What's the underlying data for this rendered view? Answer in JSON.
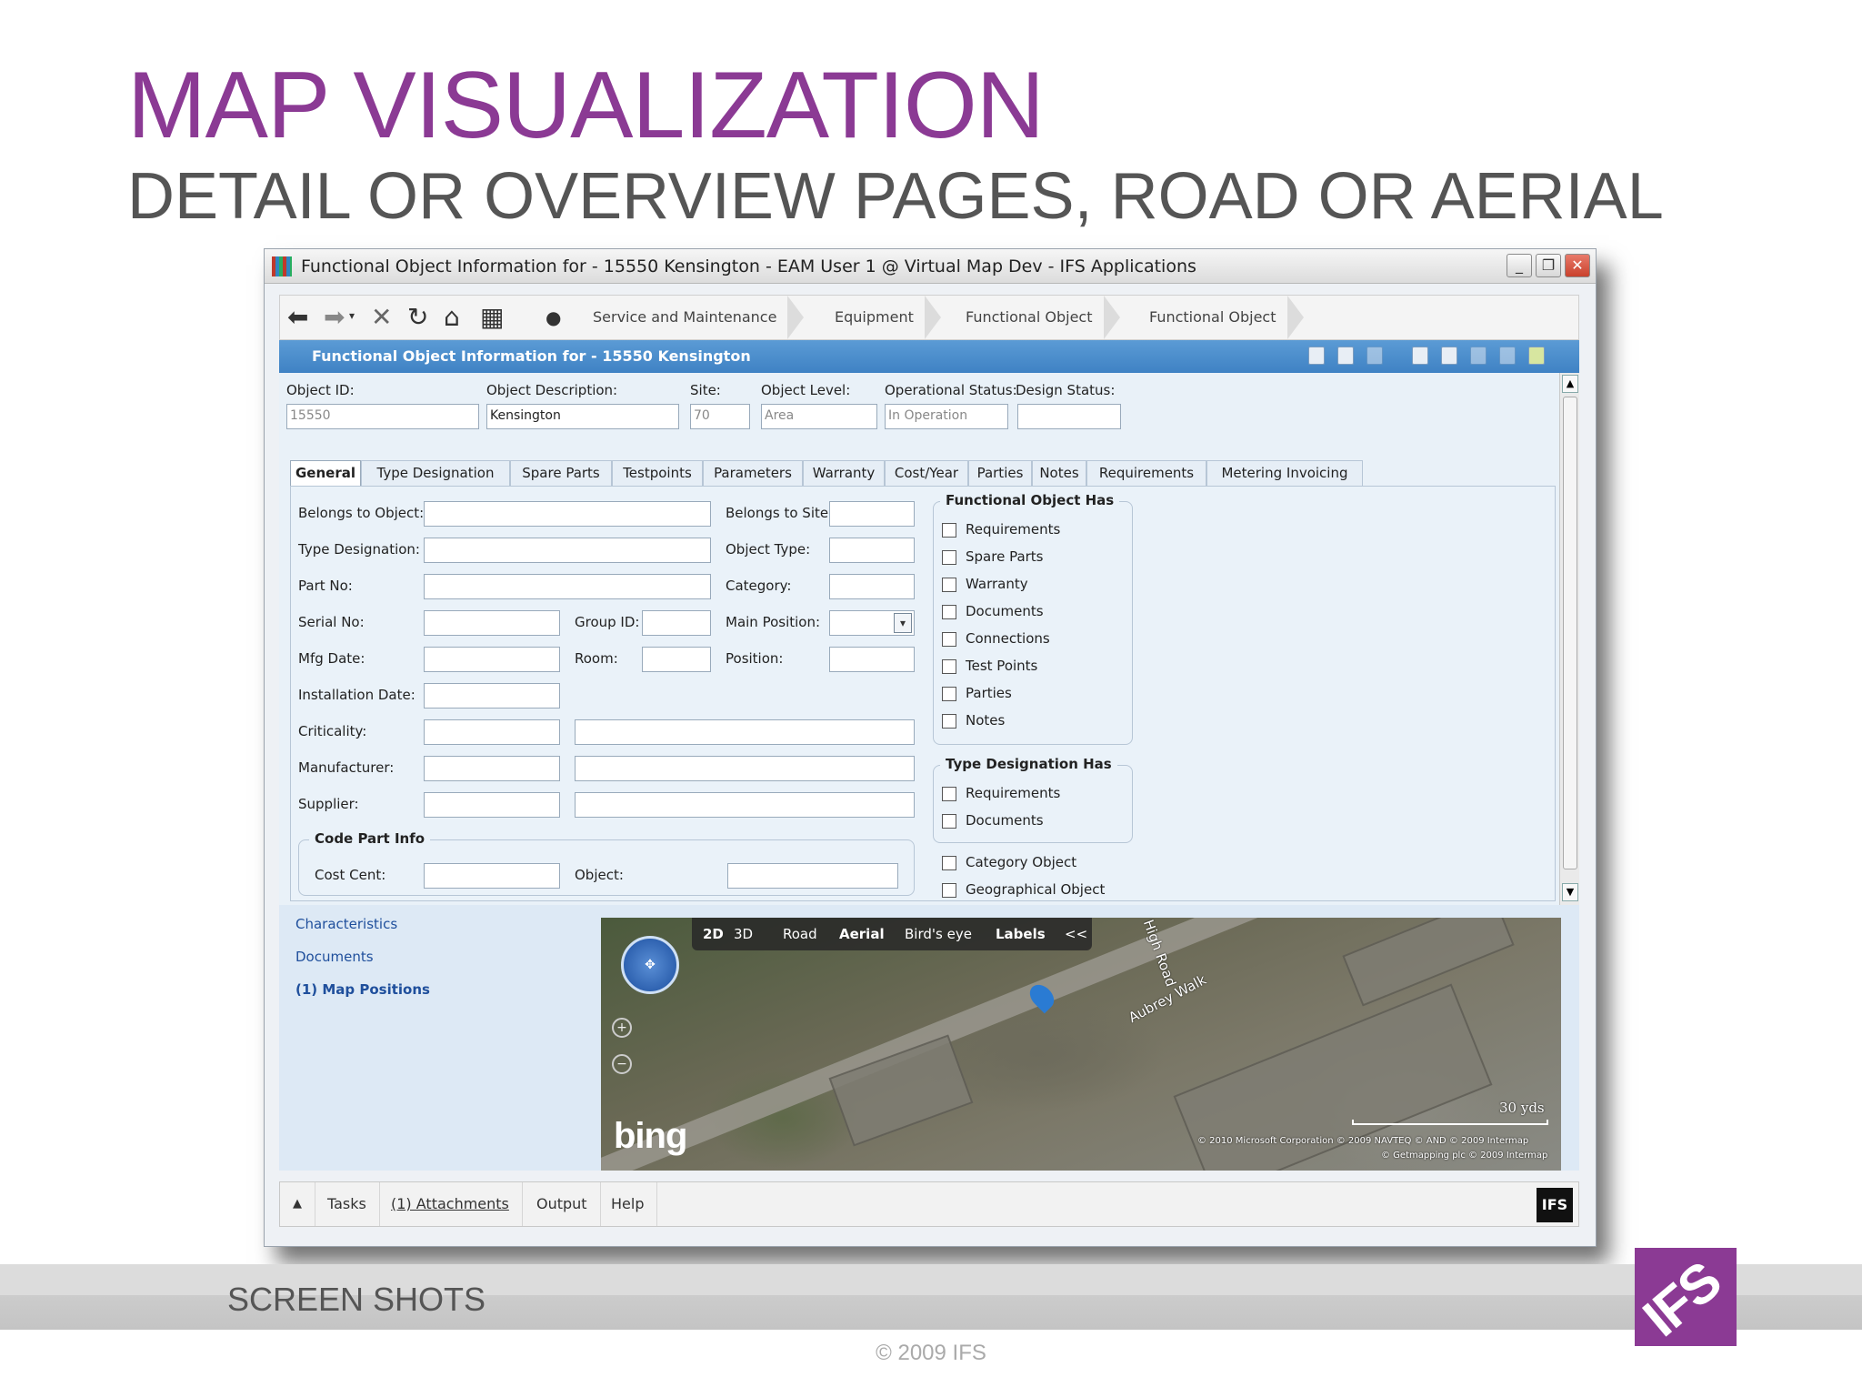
{
  "slide": {
    "title": "MAP VISUALIZATION",
    "subtitle": "DETAIL OR OVERVIEW PAGES, ROAD OR AERIAL",
    "footer_label": "SCREEN SHOTS",
    "copyright": "© 2009 IFS",
    "logo_text": "IFS",
    "accent_color": "#8b3a94"
  },
  "window": {
    "title": "Functional Object Information for - 15550 Kensington - EAM User 1 @ Virtual Map Dev - IFS Applications",
    "buttons": {
      "minimize": "_",
      "restore": "❐",
      "close": "✕"
    }
  },
  "nav": {
    "icons": [
      "back-arrow-icon",
      "forward-arrow-icon",
      "cancel-icon",
      "refresh-icon",
      "home-icon",
      "grid-icon",
      "bullet-icon"
    ],
    "breadcrumbs": [
      "Service and Maintenance",
      "Equipment",
      "Functional Object",
      "Functional Object"
    ]
  },
  "form_header": {
    "title": "Functional Object Information for - 15550 Kensington"
  },
  "header_fields": [
    {
      "label": "Object ID:",
      "value": "15550"
    },
    {
      "label": "Object Description:",
      "value": "Kensington"
    },
    {
      "label": "Site:",
      "value": "70"
    },
    {
      "label": "Object Level:",
      "value": "Area"
    },
    {
      "label": "Operational Status:",
      "value": "In Operation"
    },
    {
      "label": "Design Status:",
      "value": ""
    }
  ],
  "tabs": [
    "General",
    "Type Designation",
    "Spare Parts",
    "Testpoints",
    "Parameters",
    "Warranty",
    "Cost/Year",
    "Parties",
    "Notes",
    "Requirements",
    "Metering Invoicing"
  ],
  "general": {
    "belongs_to_object": "Belongs to Object:",
    "type_designation": "Type Designation:",
    "part_no": "Part No:",
    "serial_no": "Serial No:",
    "mfg_date": "Mfg Date:",
    "installation_date": "Installation Date:",
    "criticality": "Criticality:",
    "manufacturer": "Manufacturer:",
    "supplier": "Supplier:",
    "group_id": "Group ID:",
    "room": "Room:",
    "belongs_to_site": "Belongs to Site:",
    "object_type": "Object Type:",
    "category": "Category:",
    "main_position": "Main Position:",
    "position": "Position:",
    "code_part_info": "Code Part Info",
    "cost_cent": "Cost Cent:",
    "object": "Object:"
  },
  "functional_object_has": {
    "title": "Functional Object Has",
    "items": [
      "Requirements",
      "Spare Parts",
      "Warranty",
      "Documents",
      "Connections",
      "Test Points",
      "Parties",
      "Notes"
    ]
  },
  "type_designation_has": {
    "title": "Type Designation Has",
    "items": [
      "Requirements",
      "Documents"
    ]
  },
  "extra_checks": [
    "Category Object",
    "Geographical Object"
  ],
  "bottom_links": [
    "Characteristics",
    "Documents",
    "(1) Map Positions"
  ],
  "map": {
    "modes": [
      "2D",
      "3D",
      "Road",
      "Aerial",
      "Bird's eye",
      "Labels",
      "<<"
    ],
    "streets": [
      "High Road",
      "Aubrey Walk"
    ],
    "scale_label": "30 yds",
    "brand": "bing",
    "credits_1": "© 2010 Microsoft Corporation   © 2009 NAVTEQ   © AND   © 2009 Intermap",
    "credits_2": "© Getmapping plc   © 2009 Intermap"
  },
  "status_bar": {
    "up": "▲",
    "items": [
      "Tasks",
      "(1) Attachments",
      "Output",
      "Help"
    ],
    "logo": "IFS"
  }
}
